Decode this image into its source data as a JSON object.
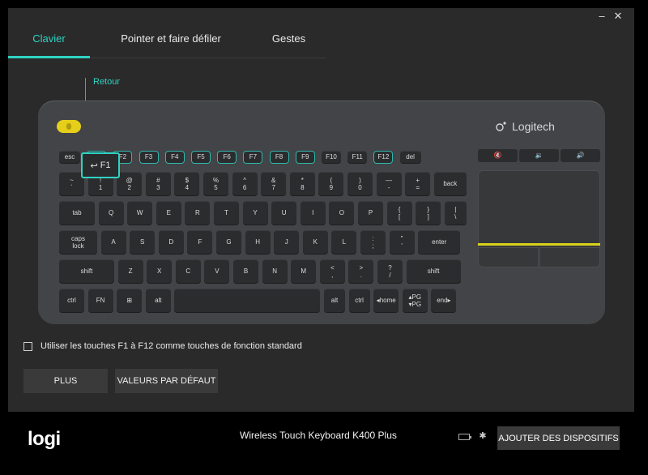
{
  "window": {
    "minimize_glyph": "–",
    "close_glyph": "✕"
  },
  "tabs": [
    {
      "label": "Clavier",
      "active": true
    },
    {
      "label": "Pointer et faire défiler",
      "active": false
    },
    {
      "label": "Gestes",
      "active": false
    }
  ],
  "callout": {
    "label": "Retour",
    "key_label": "F1",
    "key_icon": "back-arrow-icon"
  },
  "keyboard": {
    "brand": "Logitech",
    "accent_color": "#2fd3c3",
    "function_row": [
      "esc",
      "F1",
      "F2",
      "F3",
      "F4",
      "F5",
      "F6",
      "F7",
      "F8",
      "F9",
      "F10",
      "F11",
      "F12",
      "del"
    ],
    "rows": {
      "number": [
        "~\n`",
        "!\n1",
        "@\n2",
        "#\n3",
        "$\n4",
        "%\n5",
        "^\n6",
        "&\n7",
        "*\n8",
        "(\n9",
        ")\n0",
        "—\n-",
        "+\n=",
        "back"
      ],
      "top": [
        "tab",
        "Q",
        "W",
        "E",
        "R",
        "T",
        "Y",
        "U",
        "I",
        "O",
        "P",
        "{\n[",
        "}\n]",
        "|\n\\"
      ],
      "home": [
        "caps\nlock",
        "A",
        "S",
        "D",
        "F",
        "G",
        "H",
        "J",
        "K",
        "L",
        ":\n;",
        "\"\n'",
        "enter"
      ],
      "shift": [
        "shift",
        "Z",
        "X",
        "C",
        "V",
        "B",
        "N",
        "M",
        "<\n,",
        ">\n.",
        "?\n/",
        "shift"
      ],
      "bottom": [
        "ctrl",
        "FN",
        "⊞",
        "alt",
        "",
        "alt",
        "ctrl",
        "◂home",
        "▴PG\n▾PG",
        "end▸"
      ]
    },
    "media_keys": [
      "mute",
      "vol-down",
      "vol-up"
    ]
  },
  "options": {
    "fn_checkbox_label": "Utiliser les touches F1 à F12 comme touches de fonction standard",
    "fn_checkbox_checked": false
  },
  "buttons": {
    "plus": "PLUS",
    "defaults": "VALEURS PAR DÉFAUT"
  },
  "footer": {
    "logo": "logi",
    "device_name": "Wireless Touch Keyboard K400 Plus",
    "add_devices": "AJOUTER DES DISPOSITIFS"
  }
}
